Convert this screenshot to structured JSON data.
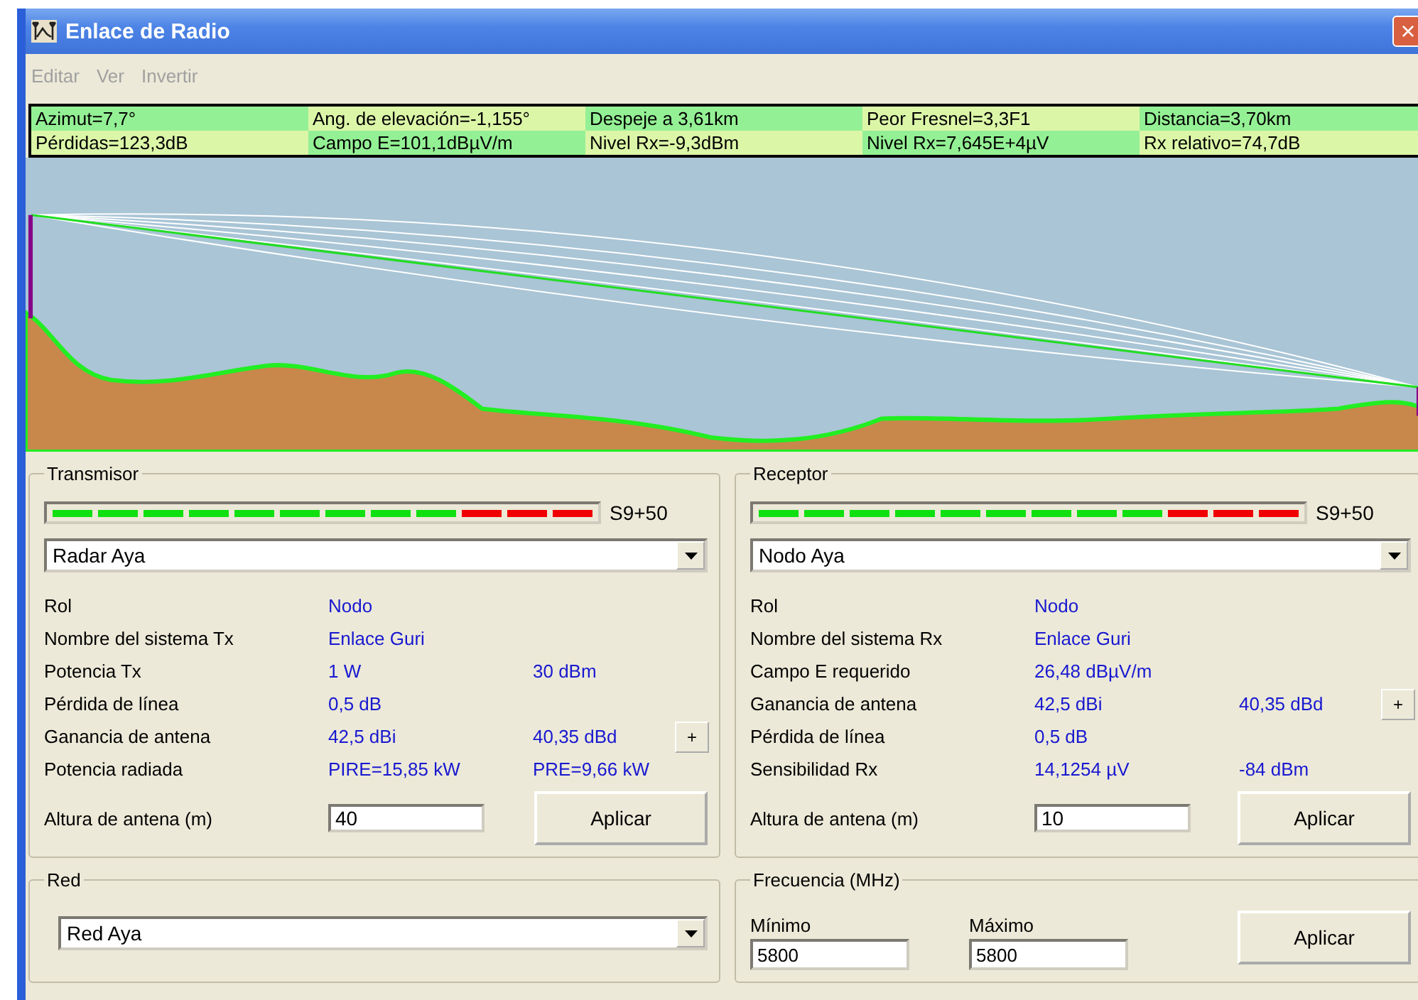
{
  "window": {
    "title": "Enlace de Radio",
    "close": "×"
  },
  "menu": [
    {
      "label": "Editar",
      "disabled": true
    },
    {
      "label": "Ver",
      "disabled": true
    },
    {
      "label": "Invertir",
      "disabled": true
    }
  ],
  "info": {
    "rows": [
      [
        "Azimut=7,7°",
        "Ang. de elevación=-1,155°",
        "Despeje a 3,61km",
        "Peor Fresnel=3,3F1",
        "Distancia=3,70km"
      ],
      [
        "Pérdidas=123,3dB",
        "Campo E=101,1dBµV/m",
        "Nivel Rx=-9,3dBm",
        "Nivel Rx=7,645E+4µV",
        "Rx relativo=74,7dB"
      ]
    ]
  },
  "panels": [
    {
      "title": "Transmisor",
      "meter": {
        "reading": "S9+50",
        "segments": [
          {
            "lit": true,
            "color": "#10e010"
          },
          {
            "lit": true,
            "color": "#10e010"
          },
          {
            "lit": true,
            "color": "#10e010"
          },
          {
            "lit": true,
            "color": "#10e010"
          },
          {
            "lit": true,
            "color": "#10e010"
          },
          {
            "lit": true,
            "color": "#10e010"
          },
          {
            "lit": true,
            "color": "#10e010"
          },
          {
            "lit": true,
            "color": "#10e010"
          },
          {
            "lit": true,
            "color": "#10e010"
          },
          {
            "lit": true,
            "color": "#f00000"
          },
          {
            "lit": true,
            "color": "#f00000"
          },
          {
            "lit": true,
            "color": "#f00000"
          }
        ]
      },
      "station": "Radar Aya",
      "rows": [
        {
          "label": "Rol",
          "value": "Nodo"
        },
        {
          "label": "Nombre del sistema Tx",
          "value": "Enlace Guri"
        },
        {
          "label": "Potencia Tx",
          "value": "1 W",
          "value_2": "30 dBm"
        },
        {
          "label": "Pérdida de línea",
          "value": "0,5 dB"
        },
        {
          "label": "Ganancia de antena",
          "value": "42,5 dBi",
          "value_2": "40,35 dBd",
          "action": "+"
        },
        {
          "label": "Potencia radiada",
          "value": "PIRE=15,85 kW",
          "value_2": "PRE=9,66 kW"
        }
      ],
      "height_label": "Altura de antena (m)",
      "height_value": "40",
      "apply": "Aplicar"
    },
    {
      "title": "Receptor",
      "meter": {
        "reading": "S9+50",
        "segments": [
          {
            "lit": true,
            "color": "#10e010"
          },
          {
            "lit": true,
            "color": "#10e010"
          },
          {
            "lit": true,
            "color": "#10e010"
          },
          {
            "lit": true,
            "color": "#10e010"
          },
          {
            "lit": true,
            "color": "#10e010"
          },
          {
            "lit": true,
            "color": "#10e010"
          },
          {
            "lit": true,
            "color": "#10e010"
          },
          {
            "lit": true,
            "color": "#10e010"
          },
          {
            "lit": true,
            "color": "#10e010"
          },
          {
            "lit": true,
            "color": "#f00000"
          },
          {
            "lit": true,
            "color": "#f00000"
          },
          {
            "lit": true,
            "color": "#f00000"
          }
        ]
      },
      "station": "Nodo Aya",
      "rows": [
        {
          "label": "Rol",
          "value": "Nodo"
        },
        {
          "label": "Nombre del sistema Rx",
          "value": "Enlace Guri"
        },
        {
          "label": "Campo E requerido",
          "value": "26,48 dBµV/m"
        },
        {
          "label": "Ganancia de antena",
          "value": "42,5 dBi",
          "value_2": "40,35 dBd",
          "action": "+"
        },
        {
          "label": "Pérdida de línea",
          "value": "0,5 dB"
        },
        {
          "label": "Sensibilidad Rx",
          "value": "14,1254 µV",
          "value_2": "-84 dBm"
        }
      ],
      "height_label": "Altura de antena (m)",
      "height_value": "10",
      "apply": "Aplicar"
    }
  ],
  "network": {
    "title": "Red",
    "value": "Red  Aya"
  },
  "frequency": {
    "title": "Frecuencia (MHz)",
    "min_label": "Mínimo",
    "min_value": "5800",
    "max_label": "Máximo",
    "max_value": "5800",
    "apply": "Aplicar"
  }
}
